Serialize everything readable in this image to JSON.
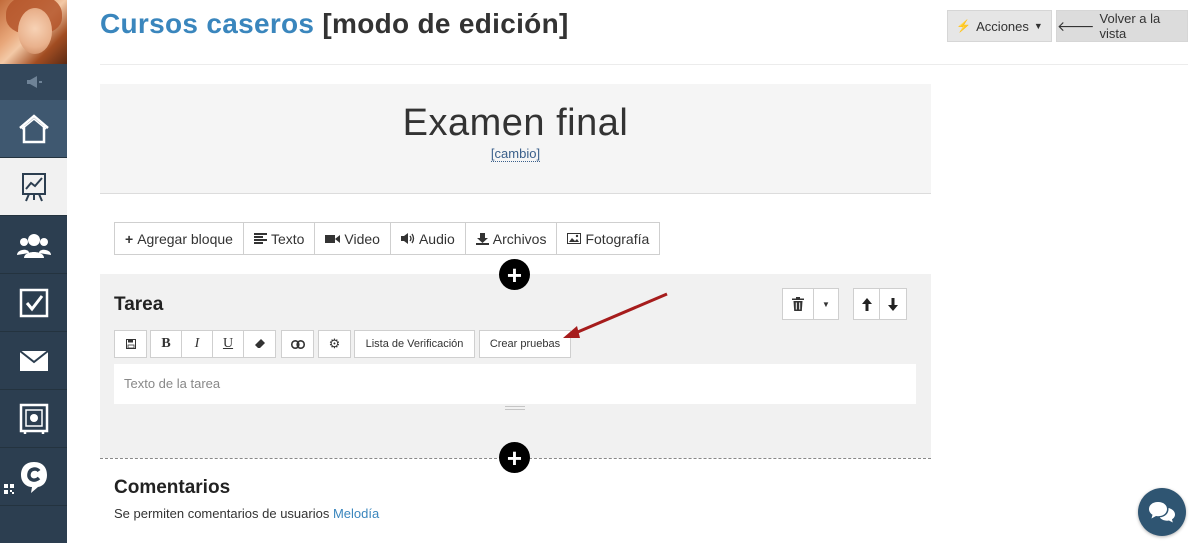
{
  "header": {
    "title_primary": "Cursos caseros",
    "title_secondary": "[modo de edición]",
    "actions_label": "Acciones",
    "back_label": "Volver a la vista"
  },
  "lesson": {
    "title": "Examen final",
    "change_link": "[cambio]"
  },
  "block_toolbar": {
    "add_block": "Agregar bloque",
    "text": "Texto",
    "video": "Video",
    "audio": "Audio",
    "files": "Archivos",
    "photo": "Fotografía"
  },
  "task": {
    "title": "Tarea",
    "checklist_label": "Lista de Verificación",
    "create_tests_label": "Crear pruebas",
    "input_placeholder": "Texto de la tarea",
    "editor_icons": [
      "save-icon",
      "bold-icon",
      "italic-icon",
      "underline-icon",
      "eraser-icon",
      "link-icon",
      "gear-icon"
    ]
  },
  "comments": {
    "title": "Comentarios",
    "text": "Se permiten comentarios de usuarios",
    "link": "Melodía"
  },
  "sidebar": {
    "items": [
      "megaphone-icon",
      "home-icon",
      "chart-icon",
      "users-icon",
      "checkbox-icon",
      "mail-icon",
      "safe-icon",
      "c-logo-icon"
    ]
  },
  "colors": {
    "sidebar_bg": "#2c3e50",
    "accent": "#3a86bd",
    "annotation_arrow": "#a61c1c"
  }
}
